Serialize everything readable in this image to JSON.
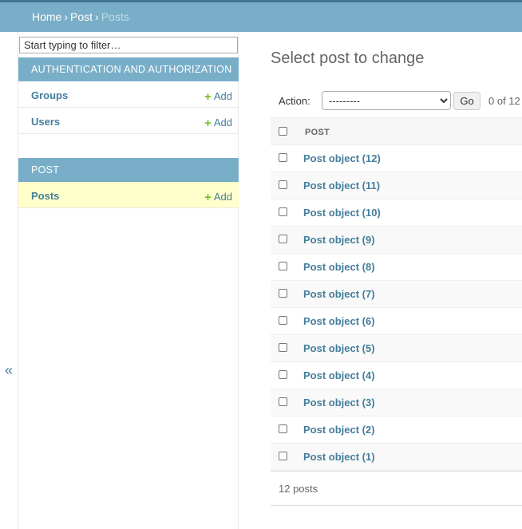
{
  "breadcrumbs": {
    "home": "Home",
    "sep1": "›",
    "app": "Post",
    "sep2": "›",
    "current": "Posts"
  },
  "sidebar": {
    "filter_placeholder": "Start typing to filter…",
    "modules": [
      {
        "caption": "AUTHENTICATION AND AUTHORIZATION",
        "models": [
          {
            "name": "Groups",
            "add": "Add"
          },
          {
            "name": "Users",
            "add": "Add"
          }
        ]
      },
      {
        "caption": "POST",
        "models": [
          {
            "name": "Posts",
            "add": "Add",
            "selected": true
          }
        ]
      }
    ],
    "collapse_label": "«"
  },
  "content": {
    "title": "Select post to change",
    "actions": {
      "label": "Action:",
      "selected_option": "---------",
      "go_label": "Go",
      "counter": "0 of 12"
    },
    "column_header": "POST",
    "rows": [
      "Post object (12)",
      "Post object (11)",
      "Post object (10)",
      "Post object (9)",
      "Post object (8)",
      "Post object (7)",
      "Post object (6)",
      "Post object (5)",
      "Post object (4)",
      "Post object (3)",
      "Post object (2)",
      "Post object (1)"
    ],
    "paginator": "12 posts"
  },
  "colors": {
    "header": "#79aec8",
    "link": "#447e9b",
    "add_plus": "#70bf2b",
    "selected_row": "#ffffcc"
  },
  "icons": {
    "add": "plus-icon",
    "collapse": "double-chevron-left-icon"
  }
}
